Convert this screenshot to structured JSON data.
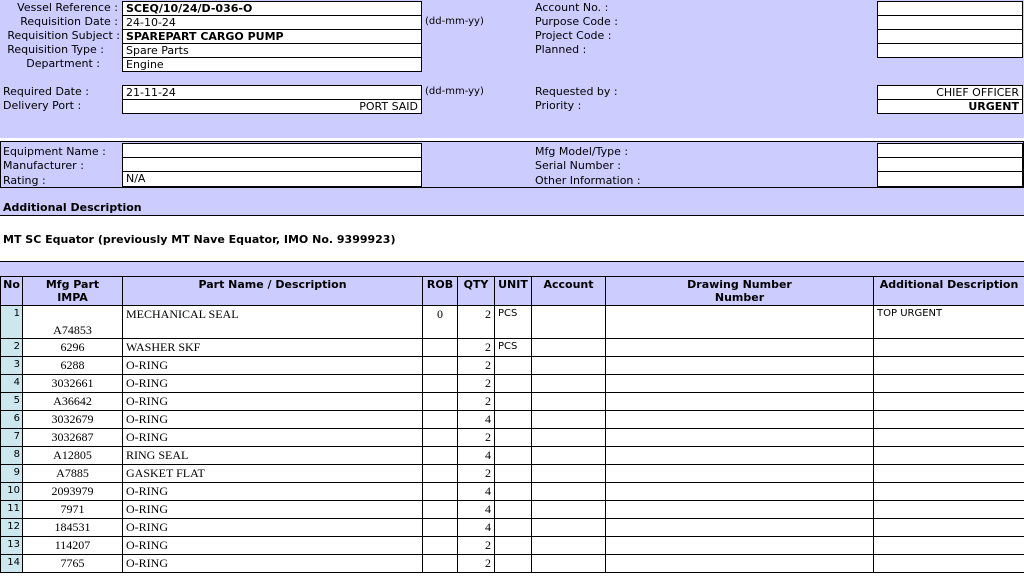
{
  "header": {
    "vessel_reference_label": "Vessel Reference :",
    "vessel_reference": "SCEQ/10/24/D-036-O",
    "requisition_date_label": "Requisition Date :",
    "requisition_date": "24-10-24",
    "date_format_1": "(dd-mm-yy)",
    "requisition_subject_label": "Requisition Subject :",
    "requisition_subject": "SPAREPART CARGO PUMP",
    "requisition_type_label": "Requisition Type :",
    "requisition_type": "Spare Parts",
    "department_label": "Department :",
    "department": "Engine",
    "account_no_label": "Account No. :",
    "account_no": "",
    "purpose_code_label": "Purpose Code :",
    "purpose_code": "",
    "project_code_label": "Project Code :",
    "project_code": "",
    "planned_label": "Planned :",
    "planned": "",
    "required_date_label": "Required Date :",
    "required_date": "21-11-24",
    "date_format_2": "(dd-mm-yy)",
    "delivery_port_label": "Delivery Port :",
    "delivery_port": "PORT SAID",
    "requested_by_label": "Requested by :",
    "requested_by": "CHIEF OFFICER",
    "priority_label": "Priority :",
    "priority": "URGENT"
  },
  "equipment": {
    "equipment_name_label": "Equipment Name :",
    "equipment_name": "",
    "manufacturer_label": "Manufacturer :",
    "manufacturer": "",
    "rating_label": "Rating :",
    "rating": "N/A",
    "mfg_model_label": "Mfg Model/Type :",
    "mfg_model": "",
    "serial_number_label": "Serial Number :",
    "serial_number": "",
    "other_info_label": "Other Information :",
    "other_info": ""
  },
  "additional": {
    "heading": "Additional Description",
    "text": "MT SC Equator (previously MT Nave Equator, IMO No. 9399923)"
  },
  "table": {
    "headers": {
      "no": "No",
      "mfg_part_1": "Mfg Part",
      "mfg_part_2": "IMPA",
      "name": "Part Name / Description",
      "rob": "ROB",
      "qty": "QTY",
      "unit": "UNIT",
      "account": "Account",
      "drawing_1": "Drawing Number",
      "drawing_2": "Number",
      "adesc": "Additional Description"
    },
    "rows": [
      {
        "no": "1",
        "part": "A74853",
        "name": "MECHANICAL SEAL",
        "rob": "0",
        "qty": "2",
        "unit": "PCS",
        "account": "",
        "drawing": "",
        "adesc": "TOP URGENT"
      },
      {
        "no": "2",
        "part": "6296",
        "name": "WASHER SKF",
        "rob": "",
        "qty": "2",
        "unit": "PCS",
        "account": "",
        "drawing": "",
        "adesc": ""
      },
      {
        "no": "3",
        "part": "6288",
        "name": "O-RING",
        "rob": "",
        "qty": "2",
        "unit": "",
        "account": "",
        "drawing": "",
        "adesc": ""
      },
      {
        "no": "4",
        "part": "3032661",
        "name": "O-RING",
        "rob": "",
        "qty": "2",
        "unit": "",
        "account": "",
        "drawing": "",
        "adesc": ""
      },
      {
        "no": "5",
        "part": "A36642",
        "name": "O-RING",
        "rob": "",
        "qty": "2",
        "unit": "",
        "account": "",
        "drawing": "",
        "adesc": ""
      },
      {
        "no": "6",
        "part": "3032679",
        "name": "O-RING",
        "rob": "",
        "qty": "4",
        "unit": "",
        "account": "",
        "drawing": "",
        "adesc": ""
      },
      {
        "no": "7",
        "part": "3032687",
        "name": "O-RING",
        "rob": "",
        "qty": "2",
        "unit": "",
        "account": "",
        "drawing": "",
        "adesc": ""
      },
      {
        "no": "8",
        "part": "A12805",
        "name": "RING SEAL",
        "rob": "",
        "qty": "4",
        "unit": "",
        "account": "",
        "drawing": "",
        "adesc": ""
      },
      {
        "no": "9",
        "part": "A7885",
        "name": "GASKET FLAT",
        "rob": "",
        "qty": "2",
        "unit": "",
        "account": "",
        "drawing": "",
        "adesc": ""
      },
      {
        "no": "10",
        "part": "2093979",
        "name": "O-RING",
        "rob": "",
        "qty": "4",
        "unit": "",
        "account": "",
        "drawing": "",
        "adesc": ""
      },
      {
        "no": "11",
        "part": "7971",
        "name": "O-RING",
        "rob": "",
        "qty": "4",
        "unit": "",
        "account": "",
        "drawing": "",
        "adesc": ""
      },
      {
        "no": "12",
        "part": "184531",
        "name": "O-RING",
        "rob": "",
        "qty": "4",
        "unit": "",
        "account": "",
        "drawing": "",
        "adesc": ""
      },
      {
        "no": "13",
        "part": "114207",
        "name": "O-RING",
        "rob": "",
        "qty": "2",
        "unit": "",
        "account": "",
        "drawing": "",
        "adesc": ""
      },
      {
        "no": "14",
        "part": "7765",
        "name": "O-RING",
        "rob": "",
        "qty": "2",
        "unit": "",
        "account": "",
        "drawing": "",
        "adesc": ""
      }
    ]
  }
}
